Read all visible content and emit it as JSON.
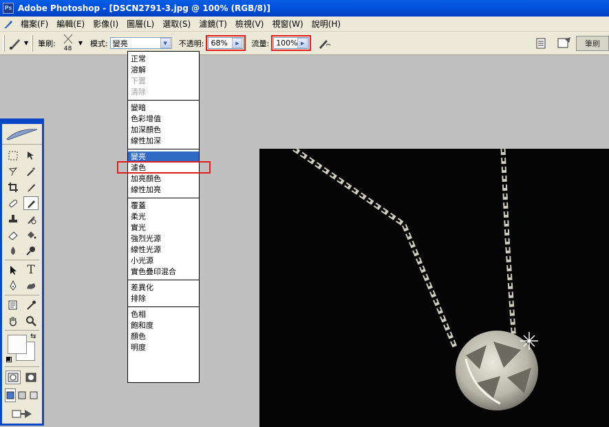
{
  "window": {
    "title": "Adobe Photoshop - [DSCN2791-3.jpg @ 100% (RGB/8)]"
  },
  "menu": [
    "檔案(F)",
    "編輯(E)",
    "影像(I)",
    "圖層(L)",
    "選取(S)",
    "濾鏡(T)",
    "檢視(V)",
    "視窗(W)",
    "說明(H)"
  ],
  "options": {
    "brush_label": "筆刷:",
    "brush_size": "48",
    "mode_label": "模式:",
    "mode_value": "變亮",
    "opacity_label": "不透明:",
    "opacity_value": "68%",
    "flow_label": "流量:",
    "flow_value": "100%",
    "palette_tab": "筆刷"
  },
  "blend_modes": [
    [
      {
        "label": "正常"
      },
      {
        "label": "溶解"
      },
      {
        "label": "下置",
        "disabled": true
      },
      {
        "label": "清除",
        "disabled": true
      }
    ],
    [
      {
        "label": "變暗"
      },
      {
        "label": "色彩增值"
      },
      {
        "label": "加深顏色"
      },
      {
        "label": "線性加深"
      }
    ],
    [
      {
        "label": "變亮",
        "selected": true
      },
      {
        "label": "濾色"
      },
      {
        "label": "加亮顏色"
      },
      {
        "label": "線性加亮"
      }
    ],
    [
      {
        "label": "覆蓋"
      },
      {
        "label": "柔光"
      },
      {
        "label": "實光"
      },
      {
        "label": "強烈光源"
      },
      {
        "label": "線性光源"
      },
      {
        "label": "小光源"
      },
      {
        "label": "實色疊印混合"
      }
    ],
    [
      {
        "label": "差異化"
      },
      {
        "label": "排除"
      }
    ],
    [
      {
        "label": "色相"
      },
      {
        "label": "飽和度"
      },
      {
        "label": "顏色"
      },
      {
        "label": "明度"
      }
    ]
  ],
  "colors": {
    "title_bar": "#0a5ee6",
    "highlight_red": "#e01c1c",
    "selection_blue": "#316ac5"
  }
}
